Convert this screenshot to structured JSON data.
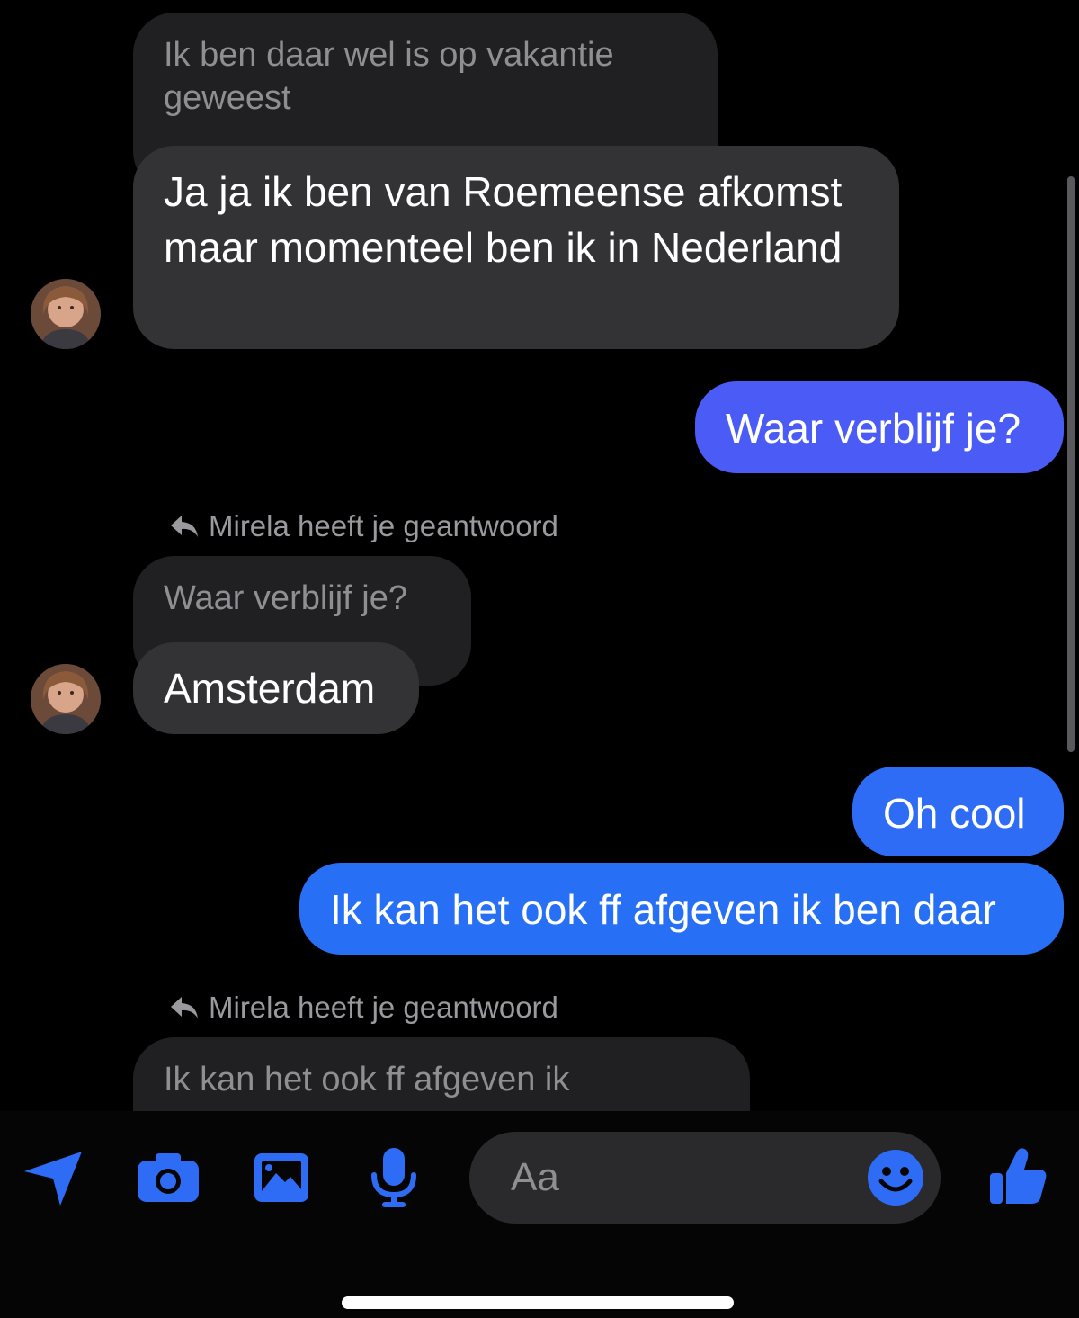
{
  "messages": {
    "quoted_1": "Ik ben daar wel is op vakantie geweest",
    "incoming_1": "Ja ja ik ben van Roemeense afkomst maar momenteel ben ik in Nederland",
    "outgoing_1": "Waar verblijf je?",
    "reply_note_1": "Mirela heeft je geantwoord",
    "quoted_2": "Waar verblijf je?",
    "incoming_2": "Amsterdam",
    "outgoing_2": "Oh cool",
    "outgoing_3": "Ik kan het ook ff afgeven ik ben daar",
    "reply_note_2": "Mirela heeft je geantwoord",
    "quoted_3": "Ik kan het ook ff afgeven ik"
  },
  "composer": {
    "placeholder": "Aa",
    "icons": [
      "location-icon",
      "camera-icon",
      "gallery-icon",
      "microphone-icon",
      "emoji-icon",
      "thumbs-up-icon"
    ]
  },
  "colors": {
    "accent": "#2f6cf5",
    "outgoing_bubble": "#4a5cf5",
    "incoming_bubble": "#333335",
    "background": "#000000"
  }
}
